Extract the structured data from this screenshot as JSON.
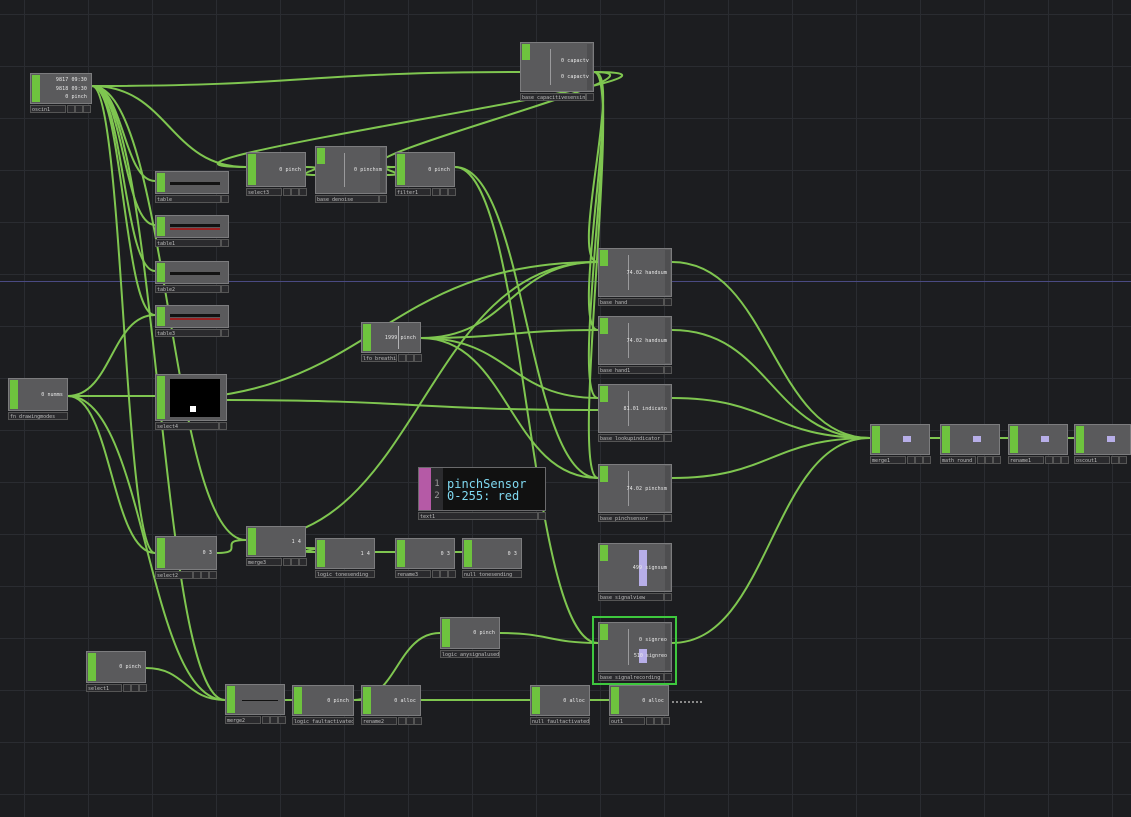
{
  "nodes": {
    "oscin1": {
      "label": "oscin1",
      "v1": "9817 09:30",
      "v2": "9818 09:30",
      "v3": "0 pinch"
    },
    "base_capacitivesensing": {
      "label": "base_capacitivesensing",
      "v1": "0 capactv",
      "v2": "0 capactv"
    },
    "table": {
      "label": "table"
    },
    "table1": {
      "label": "table1"
    },
    "table2": {
      "label": "table2"
    },
    "table3": {
      "label": "table3"
    },
    "select3": {
      "label": "select3",
      "value": "0 pinch"
    },
    "base_denoise": {
      "label": "base_denoise",
      "value": "0 pinchsm"
    },
    "filter1": {
      "label": "filter1",
      "value": "0 pinch"
    },
    "base_hand": {
      "label": "base_hand",
      "value": "74.02 handsum"
    },
    "base_hand1": {
      "label": "base_hand1",
      "value": "74.02 handsum"
    },
    "lfo_breathing": {
      "label": "lfo_breathing",
      "value": "1999 pinch"
    },
    "base_lookupindicator": {
      "label": "base_lookupindicator",
      "value": "81.01 indicato"
    },
    "fn_drawingmodes": {
      "label": "fn_drawingmodes",
      "value": "0 numms"
    },
    "select4": {
      "label": "select4"
    },
    "text1": {
      "label": "text1",
      "line_numbers": [
        "1",
        "2"
      ],
      "lines": [
        "pinchSensor",
        "0-255: red"
      ]
    },
    "base_pinchsensor": {
      "label": "base_pinchsensor",
      "value": "74.02 pinchsm"
    },
    "select2": {
      "label": "select2",
      "value": "0 3"
    },
    "merge3": {
      "label": "merge3",
      "value": "1 4"
    },
    "logic_tonesending": {
      "label": "logic_tonesending",
      "value": "1 4"
    },
    "rename3": {
      "label": "rename3",
      "value": "0 3"
    },
    "null_tonesending": {
      "label": "null_tonesending",
      "value": "0 3"
    },
    "base_signalview": {
      "label": "base_signalview",
      "value": "499 signsum"
    },
    "logic_anysignalused": {
      "label": "logic_anysignalused",
      "value": "0 pinch"
    },
    "base_signalrecording": {
      "label": "base_signalrecording",
      "v1": "0 signreo",
      "v2": "510 signreo"
    },
    "select1": {
      "label": "select1",
      "value": "0 pinch"
    },
    "merge2": {
      "label": "merge2"
    },
    "logic_faultactivated": {
      "label": "logic_faultactivated",
      "value": "0 pinch"
    },
    "rename2": {
      "label": "rename2",
      "value": "0 alloc"
    },
    "null_faultactivated": {
      "label": "null_faultactivated",
      "value": "0 alloc"
    },
    "out1": {
      "label": "out1",
      "value": "0 alloc"
    },
    "merge1": {
      "label": "merge1"
    },
    "math_round": {
      "label": "math_round"
    },
    "rename1": {
      "label": "rename1"
    },
    "oscout1": {
      "label": "oscout1"
    }
  },
  "colors": {
    "background": "#1c1d20",
    "wire": "#7fc650",
    "flag": "#6ec33e",
    "selected": "#3ec83e",
    "text_code": "#7fd8f0"
  }
}
